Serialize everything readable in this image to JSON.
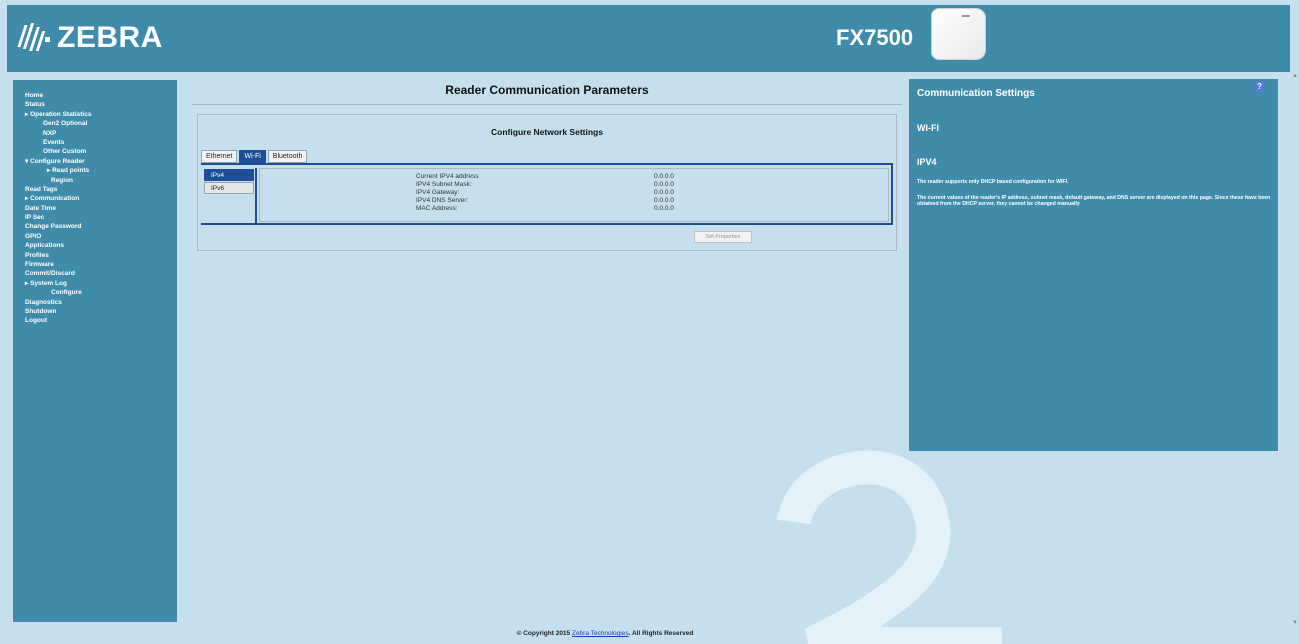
{
  "header": {
    "brand": "ZEBRA",
    "model": "FX7500"
  },
  "sidebar": {
    "items": [
      {
        "label": "Home",
        "level": 0
      },
      {
        "label": "Status",
        "level": 0
      },
      {
        "label": "▸ Operation Statistics",
        "level": 0
      },
      {
        "label": "Gen2 Optional",
        "level": 1
      },
      {
        "label": "NXP",
        "level": 1
      },
      {
        "label": "Events",
        "level": 1
      },
      {
        "label": "Other Custom",
        "level": 1
      },
      {
        "label": "▾ Configure Reader",
        "level": 0
      },
      {
        "label": "▸ Read points",
        "level": 2
      },
      {
        "label": "Region",
        "level": 3
      },
      {
        "label": "Read Tags",
        "level": 0
      },
      {
        "label": "▸ Communication",
        "level": 0
      },
      {
        "label": "Date Time",
        "level": 0
      },
      {
        "label": "IP Sec",
        "level": 0
      },
      {
        "label": "Change Password",
        "level": 0
      },
      {
        "label": "GPIO",
        "level": 0
      },
      {
        "label": "Applications",
        "level": 0
      },
      {
        "label": "Profiles",
        "level": 0
      },
      {
        "label": "Firmware",
        "level": 0
      },
      {
        "label": "Commit/Discard",
        "level": 0
      },
      {
        "label": "▸ System Log",
        "level": 0
      },
      {
        "label": "Configure",
        "level": 3
      },
      {
        "label": "Diagnostics",
        "level": 0
      },
      {
        "label": "Shutdown",
        "level": 0
      },
      {
        "label": "Logout",
        "level": 0
      }
    ]
  },
  "main": {
    "title": "Reader Communication Parameters",
    "panel_title": "Configure Network Settings",
    "tabs": [
      "Ethernet",
      "Wi-Fi",
      "Bluetooth"
    ],
    "active_tab": "Wi-Fi",
    "subtabs": [
      "IPv4",
      "IPv6"
    ],
    "active_subtab": "IPv4",
    "fields": [
      {
        "label": "Current IPV4 address",
        "value": "0.0.0.0"
      },
      {
        "label": "IPV4 Subnet Mask:",
        "value": "0.0.0.0"
      },
      {
        "label": "IPV4 Gateway:",
        "value": "0.0.0.0"
      },
      {
        "label": "IPV4 DNS Server:",
        "value": "0.0.0.0"
      },
      {
        "label": "MAC Address:",
        "value": "0.0.0.0"
      }
    ],
    "set_button": "Set Properties"
  },
  "help": {
    "icon": "?",
    "title": "Communication Settings",
    "section1": "WI-FI",
    "section2": "IPV4",
    "para1": "The reader supports only DHCP based configuration for WIFI.",
    "para2": "The current values of the reader's IP address, subnet mask, default gateway, and DNS server are displayed on this page. Since these have been obtained from the DHCP server, they cannot be changed manually"
  },
  "footer": {
    "prefix": "© Copyright 2015 ",
    "link": "Zebra Technologies",
    "suffix": ". All Rights Reserved"
  },
  "colors": {
    "panel_blue": "#3f8caa",
    "page_bg": "#c5e0ec",
    "tab_active": "#1e4e98"
  }
}
